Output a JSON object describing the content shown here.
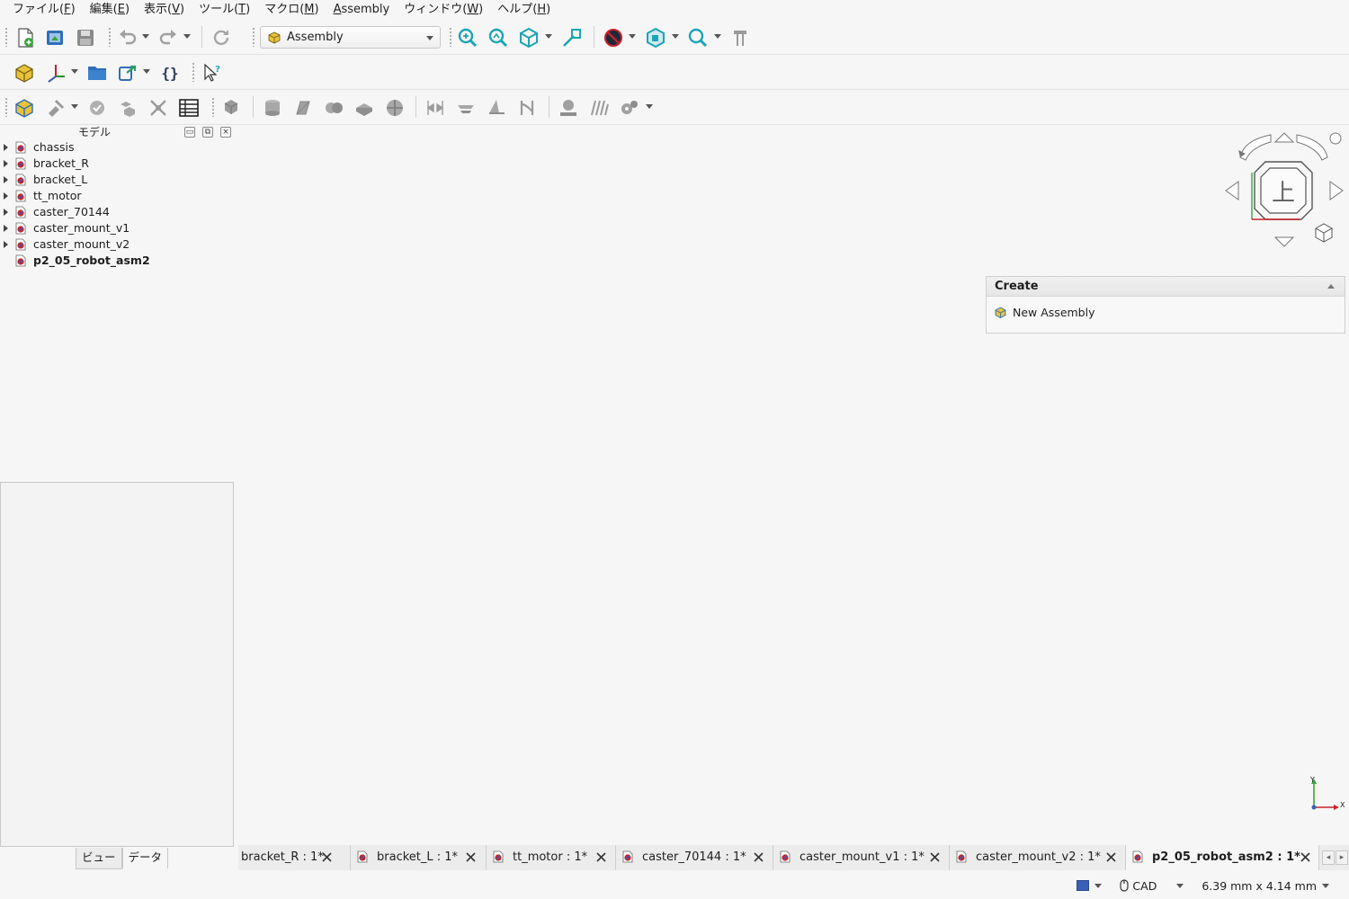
{
  "menu": [
    {
      "label": "ファイル(",
      "key": "F",
      "suffix": ")"
    },
    {
      "label": "編集(",
      "key": "E",
      "suffix": ")"
    },
    {
      "label": "表示(",
      "key": "V",
      "suffix": ")"
    },
    {
      "label": "ツール(",
      "key": "T",
      "suffix": ")"
    },
    {
      "label": "マクロ(",
      "key": "M",
      "suffix": ")"
    },
    {
      "label": "",
      "key": "A",
      "suffix": "ssembly"
    },
    {
      "label": "ウィンドウ(",
      "key": "W",
      "suffix": ")"
    },
    {
      "label": "ヘルプ(",
      "key": "H",
      "suffix": ")"
    }
  ],
  "workbench": {
    "selected": "Assembly"
  },
  "left_panel": {
    "title": "モデル",
    "tree": [
      {
        "label": "chassis",
        "expandable": true
      },
      {
        "label": "bracket_R",
        "expandable": true
      },
      {
        "label": "bracket_L",
        "expandable": true
      },
      {
        "label": "tt_motor",
        "expandable": true
      },
      {
        "label": "caster_70144",
        "expandable": true
      },
      {
        "label": "caster_mount_v1",
        "expandable": true
      },
      {
        "label": "caster_mount_v2",
        "expandable": true
      },
      {
        "label": "p2_05_robot_asm2",
        "expandable": false,
        "active": true
      }
    ],
    "tabs": [
      {
        "label": "ビュー",
        "active": false
      },
      {
        "label": "データ",
        "active": true
      }
    ]
  },
  "navcube": {
    "face_label": "上"
  },
  "task_panel": {
    "title": "Create",
    "items": [
      {
        "label": "New Assembly",
        "icon": "assembly-icon"
      }
    ]
  },
  "axis_triad": {
    "x": "X",
    "y": "Y"
  },
  "doc_tabs": [
    {
      "label": "bracket_R : 1*",
      "active": false
    },
    {
      "label": "bracket_L : 1*",
      "active": false
    },
    {
      "label": "tt_motor : 1*",
      "active": false
    },
    {
      "label": "caster_70144 : 1*",
      "active": false
    },
    {
      "label": "caster_mount_v1 : 1*",
      "active": false
    },
    {
      "label": "caster_mount_v2 : 1*",
      "active": false
    },
    {
      "label": "p2_05_robot_asm2 : 1*",
      "active": true
    }
  ],
  "status": {
    "nav_style": "CAD",
    "dimensions": "6.39 mm x 4.14 mm"
  },
  "colors": {
    "accent_cyan": "#1ba5b5",
    "doc_icon_red": "#c8202a",
    "doc_icon_blue": "#3a5fb8",
    "assembly_yellow": "#e8c23a",
    "folder_blue": "#2f6fb8"
  }
}
